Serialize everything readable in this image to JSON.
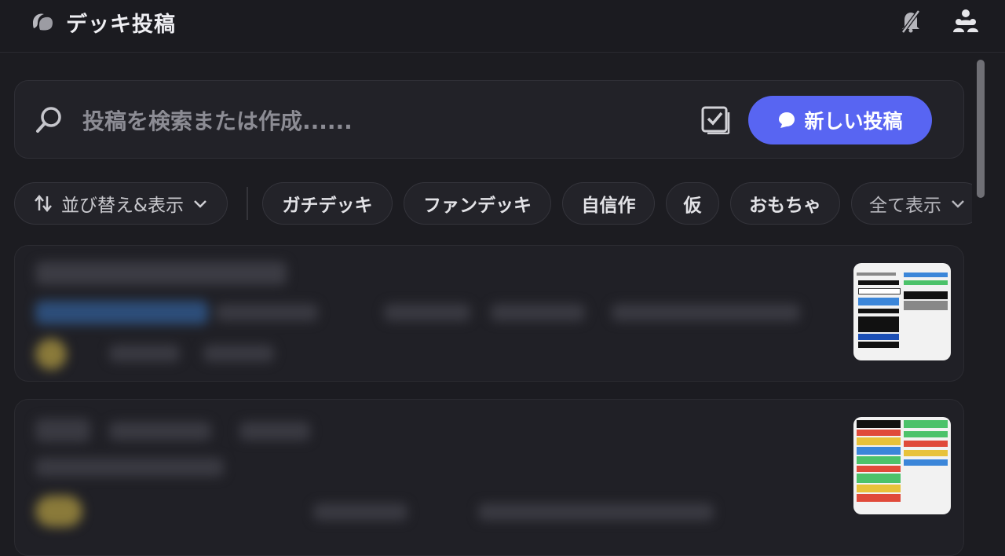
{
  "header": {
    "title": "デッキ投稿",
    "icons": [
      "forum-channel-icon",
      "notifications-muted-icon",
      "members-icon"
    ]
  },
  "search": {
    "placeholder": "投稿を検索または作成......",
    "new_post_label": "新しい投稿"
  },
  "filters": {
    "sort_label": "並び替え&表示",
    "tags": [
      "ガチデッキ",
      "ファンデッキ",
      "自信作",
      "仮",
      "おもちゃ"
    ],
    "show_all_label": "全て表示"
  },
  "colors": {
    "accent": "#5865f2",
    "background": "#1c1c21"
  }
}
